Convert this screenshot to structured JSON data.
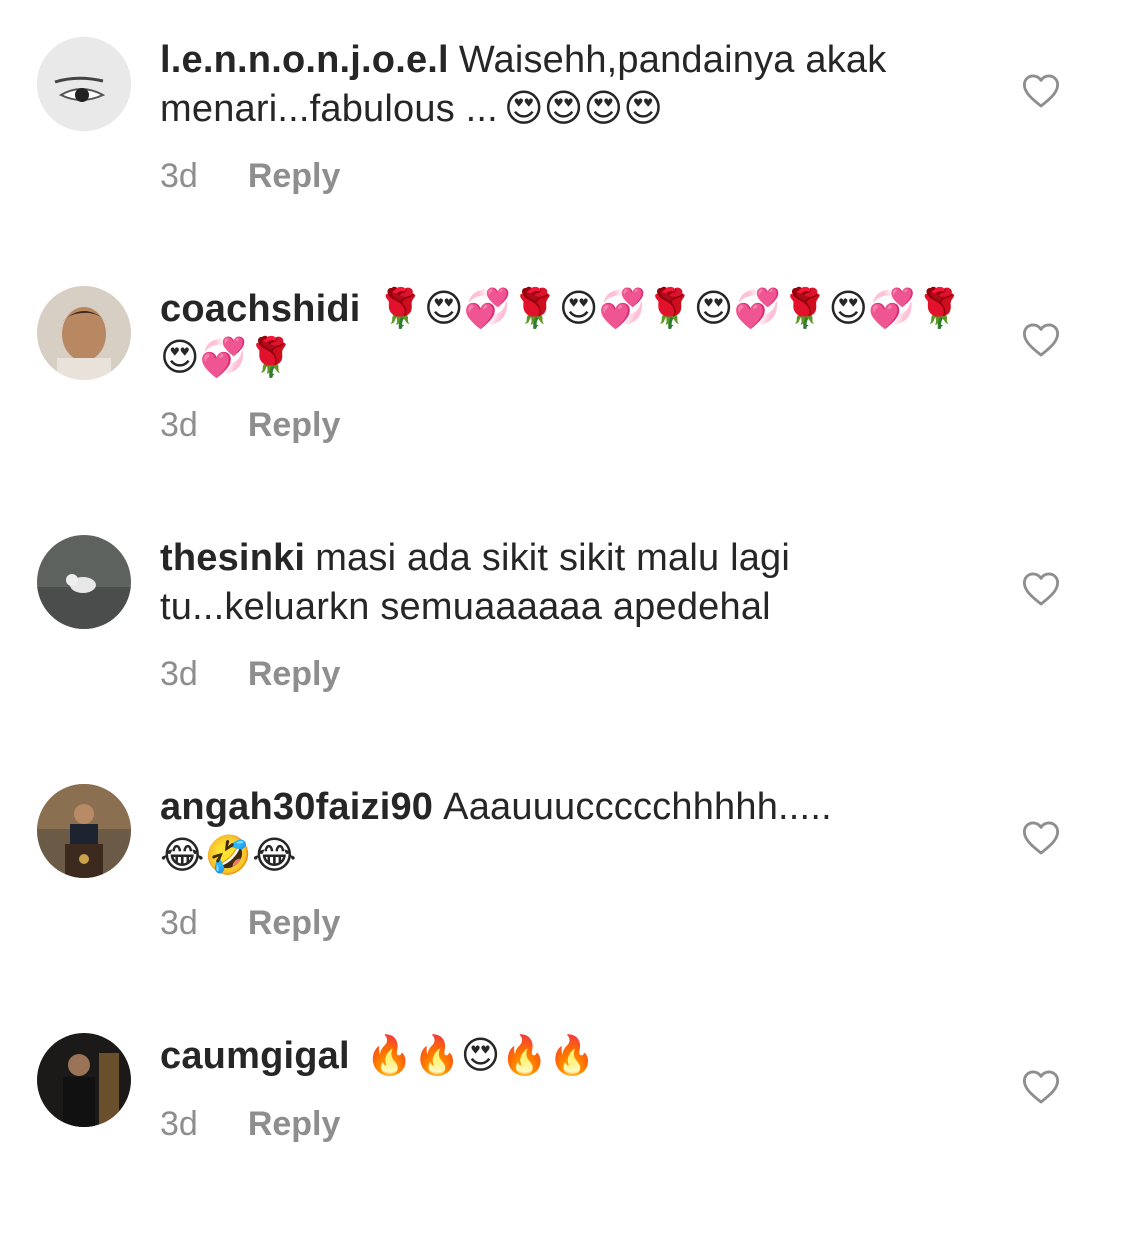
{
  "reply_label": "Reply",
  "comments": [
    {
      "username": "l.e.n.n.o.n.j.o.e.l",
      "text": "Waisehh,pandainya akak menari...fabulous ...",
      "emoji": "😍😍😍😍",
      "time": "3d",
      "avatar": "eye-drawing"
    },
    {
      "username": "coachshidi",
      "text": "",
      "emoji": "🌹😍💞🌹😍💞🌹😍💞🌹😍💞🌹😍💞🌹",
      "time": "3d",
      "avatar": "man-portrait"
    },
    {
      "username": "thesinki",
      "text": "masi ada sikit sikit malu lagi tu...keluarkn semuaaaaaa apedehal",
      "emoji": "",
      "time": "3d",
      "avatar": "cat-photo"
    },
    {
      "username": "angah30faizi90",
      "text": "Aaauuuccccchhhhh.....",
      "emoji": "😂🤣😂",
      "time": "3d",
      "avatar": "speaker-podium"
    },
    {
      "username": "caumgigal",
      "text": "",
      "emoji": "🔥🔥😍🔥🔥",
      "time": "3d",
      "avatar": "man-dark-photo"
    }
  ]
}
